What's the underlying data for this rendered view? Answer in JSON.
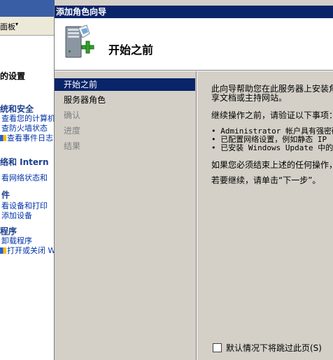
{
  "background_window": {
    "toolbar_label": "面板",
    "toolbar_arrow": "▾",
    "settings_heading": "的设置",
    "sections": [
      {
        "title": "统和安全",
        "links": [
          "查看您的计算机",
          "查防火墙状态",
          "查看事件日志"
        ]
      },
      {
        "title": "络和 Intern",
        "links": [
          "看网络状态和"
        ]
      },
      {
        "title": "件",
        "links": [
          "看设备和打印",
          "添加设备"
        ]
      },
      {
        "title": "程序",
        "links": [
          "卸载程序",
          "打开或关闭 W"
        ]
      }
    ]
  },
  "wizard": {
    "title": "添加角色向导",
    "page_title": "开始之前",
    "icon_name": "server-add-icon",
    "nav": [
      {
        "label": "开始之前",
        "state": "selected"
      },
      {
        "label": "服务器角色",
        "state": "enabled"
      },
      {
        "label": "确认",
        "state": "disabled"
      },
      {
        "label": "进度",
        "state": "disabled"
      },
      {
        "label": "结果",
        "state": "disabled"
      }
    ],
    "content": {
      "intro_line1": "此向导帮助您在此服务器上安装角",
      "intro_line2": "享文档或主持网站。",
      "verify": "继续操作之前，请验证以下事项：",
      "bullets": [
        "• Administrator 帐户具有强密码",
        "• 已配置网络设置，例如静态 IP",
        "• 已安装 Windows Update 中的最"
      ],
      "if_line": "如果您必须结束上述的任何操作，",
      "continue_line": "若要继续，请单击“下一步”。"
    },
    "skip_checkbox_label": "默认情况下将跳过此页(S)",
    "skip_checked": false
  }
}
